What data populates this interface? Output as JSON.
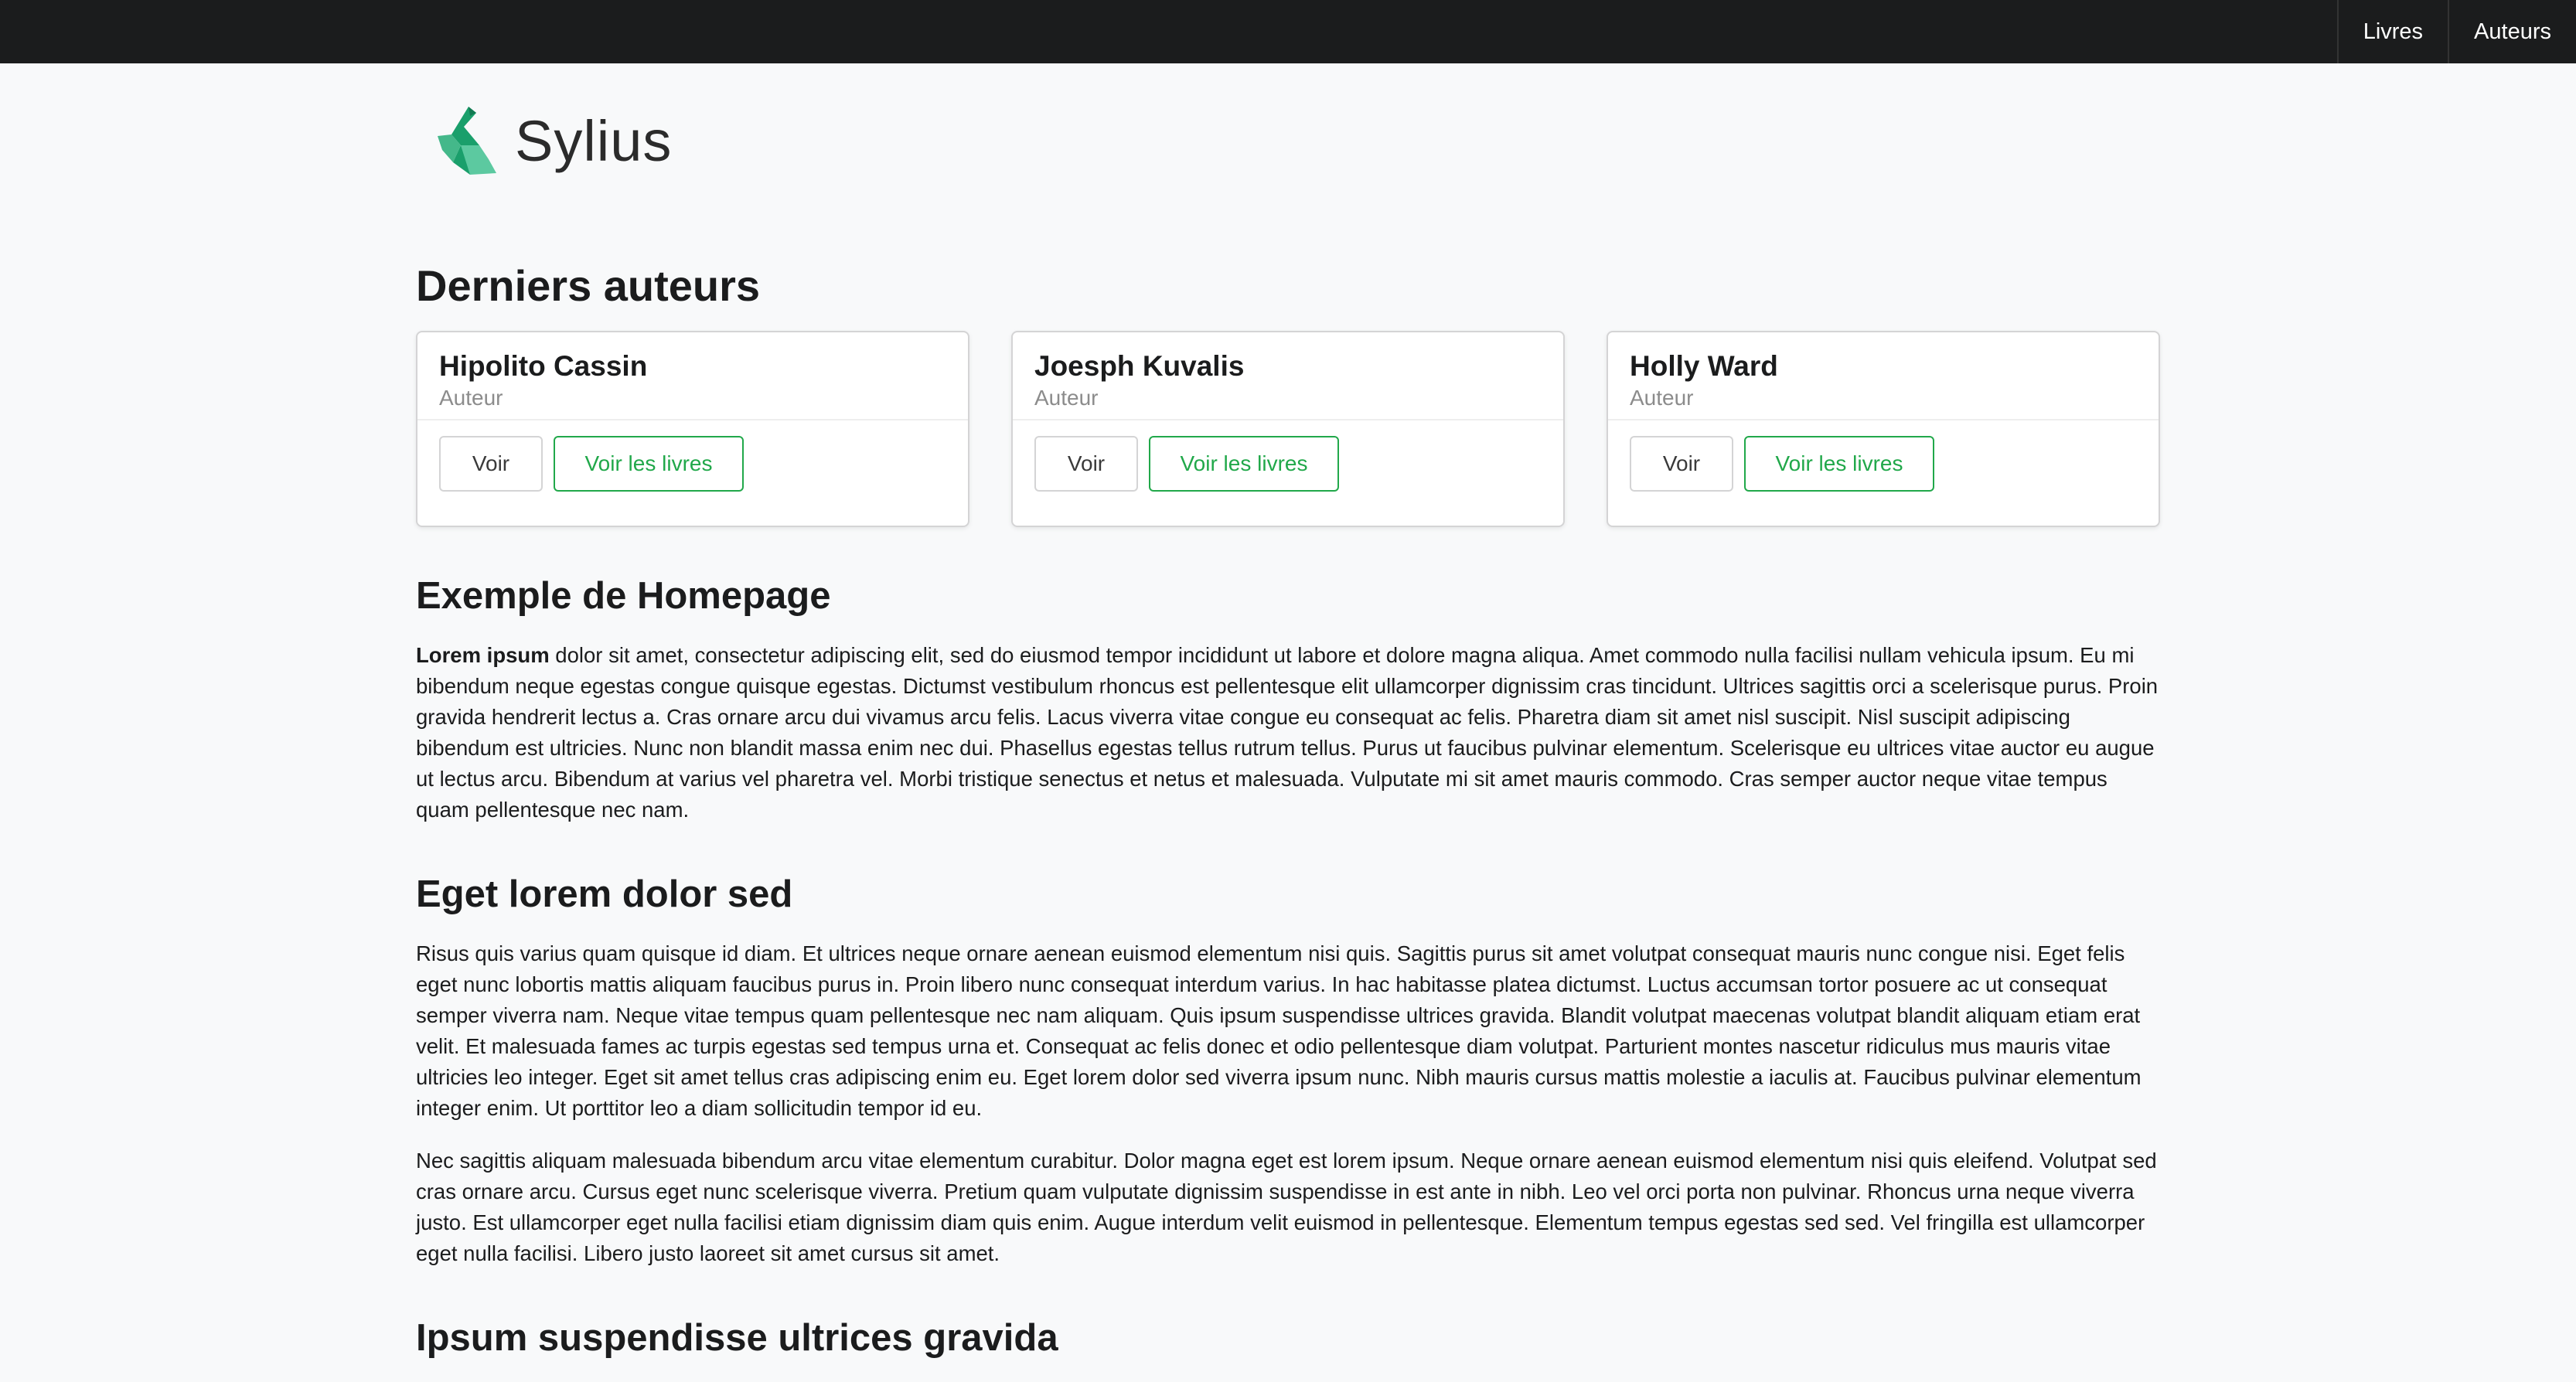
{
  "topnav": {
    "items": [
      "Livres",
      "Auteurs"
    ]
  },
  "logo": {
    "text": "Sylius"
  },
  "authors_section": {
    "title": "Derniers auteurs",
    "cards": [
      {
        "name": "Hipolito Cassin",
        "role": "Auteur",
        "view_label": "Voir",
        "books_label": "Voir les livres"
      },
      {
        "name": "Joesph Kuvalis",
        "role": "Auteur",
        "view_label": "Voir",
        "books_label": "Voir les livres"
      },
      {
        "name": "Holly Ward",
        "role": "Auteur",
        "view_label": "Voir",
        "books_label": "Voir les livres"
      }
    ]
  },
  "article": {
    "h1": "Exemple de Homepage",
    "p1_bold": "Lorem ipsum",
    "p1_rest": " dolor sit amet, consectetur adipiscing elit, sed do eiusmod tempor incididunt ut labore et dolore magna aliqua. Amet commodo nulla facilisi nullam vehicula ipsum. Eu mi bibendum neque egestas congue quisque egestas. Dictumst vestibulum rhoncus est pellentesque elit ullamcorper dignissim cras tincidunt. Ultrices sagittis orci a scelerisque purus. Proin gravida hendrerit lectus a. Cras ornare arcu dui vivamus arcu felis. Lacus viverra vitae congue eu consequat ac felis. Pharetra diam sit amet nisl suscipit. Nisl suscipit adipiscing bibendum est ultricies. Nunc non blandit massa enim nec dui. Phasellus egestas tellus rutrum tellus. Purus ut faucibus pulvinar elementum. Scelerisque eu ultrices vitae auctor eu augue ut lectus arcu. Bibendum at varius vel pharetra vel. Morbi tristique senectus et netus et malesuada. Vulputate mi sit amet mauris commodo. Cras semper auctor neque vitae tempus quam pellentesque nec nam.",
    "h2": "Eget lorem dolor sed",
    "p2": "Risus quis varius quam quisque id diam. Et ultrices neque ornare aenean euismod elementum nisi quis. Sagittis purus sit amet volutpat consequat mauris nunc congue nisi. Eget felis eget nunc lobortis mattis aliquam faucibus purus in. Proin libero nunc consequat interdum varius. In hac habitasse platea dictumst. Luctus accumsan tortor posuere ac ut consequat semper viverra nam. Neque vitae tempus quam pellentesque nec nam aliquam. Quis ipsum suspendisse ultrices gravida. Blandit volutpat maecenas volutpat blandit aliquam etiam erat velit. Et malesuada fames ac turpis egestas sed tempus urna et. Consequat ac felis donec et odio pellentesque diam volutpat. Parturient montes nascetur ridiculus mus mauris vitae ultricies leo integer. Eget sit amet tellus cras adipiscing enim eu. Eget lorem dolor sed viverra ipsum nunc. Nibh mauris cursus mattis molestie a iaculis at. Faucibus pulvinar elementum integer enim. Ut porttitor leo a diam sollicitudin tempor id eu.",
    "p3": "Nec sagittis aliquam malesuada bibendum arcu vitae elementum curabitur. Dolor magna eget est lorem ipsum. Neque ornare aenean euismod elementum nisi quis eleifend. Volutpat sed cras ornare arcu. Cursus eget nunc scelerisque viverra. Pretium quam vulputate dignissim suspendisse in est ante in nibh. Leo vel orci porta non pulvinar. Rhoncus urna neque viverra justo. Est ullamcorper eget nulla facilisi etiam dignissim diam quis enim. Augue interdum velit euismod in pellentesque. Elementum tempus egestas sed sed. Vel fringilla est ullamcorper eget nulla facilisi. Libero justo laoreet sit amet cursus sit amet.",
    "h3": "Ipsum suspendisse ultrices gravida"
  }
}
